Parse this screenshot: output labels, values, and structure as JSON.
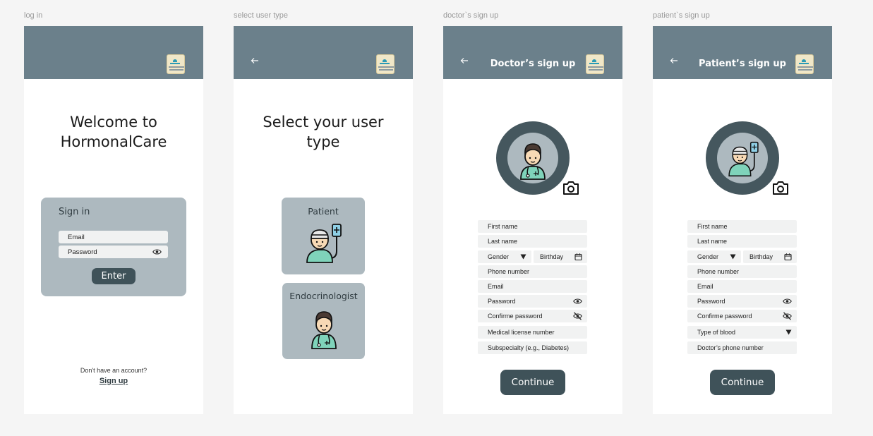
{
  "frames": {
    "login": "log in",
    "select": "select user type",
    "doctor": "doctor`s sign up",
    "patient": "patient`s sign up"
  },
  "login": {
    "heading_line1": "Welcome to",
    "heading_line2": "HormonalCare",
    "card_title": "Sign in",
    "email_placeholder": "Email",
    "password_placeholder": "Password",
    "enter_label": "Enter",
    "signup_prompt": "Don't have an account?",
    "signup_link": "Sign up"
  },
  "select": {
    "heading_line1": "Select your user",
    "heading_line2": "type",
    "patient_label": "Patient",
    "endo_label": "Endocrinologist"
  },
  "doctor": {
    "title": "Doctor’s sign up",
    "first_name": "First name",
    "last_name": "Last name",
    "gender": "Gender",
    "birthday": "Birthday",
    "phone": "Phone number",
    "email": "Email",
    "password": "Password",
    "confirm_password": "Confirme password",
    "license": "Medical license number",
    "subspecialty": "Subspecialty (e.g., Diabetes)",
    "continue_label": "Continue"
  },
  "patient": {
    "title": "Patient’s sign up",
    "first_name": "First name",
    "last_name": "Last name",
    "gender": "Gender",
    "birthday": "Birthday",
    "phone": "Phone number",
    "email": "Email",
    "password": "Password",
    "confirm_password": "Confirme password",
    "blood_type": "Type of blood",
    "doctor_phone": "Doctor’s phone number",
    "continue_label": "Continue"
  },
  "icons": {
    "back": "arrow-left-icon",
    "eye": "eye-icon",
    "eye_off": "eye-off-icon",
    "calendar": "calendar-icon",
    "camera": "camera-icon",
    "caret": "caret-down-icon"
  },
  "colors": {
    "topbar": "#6b808b",
    "card": "#adb9bf",
    "button": "#3f5259",
    "avatar_ring": "#45575e"
  }
}
